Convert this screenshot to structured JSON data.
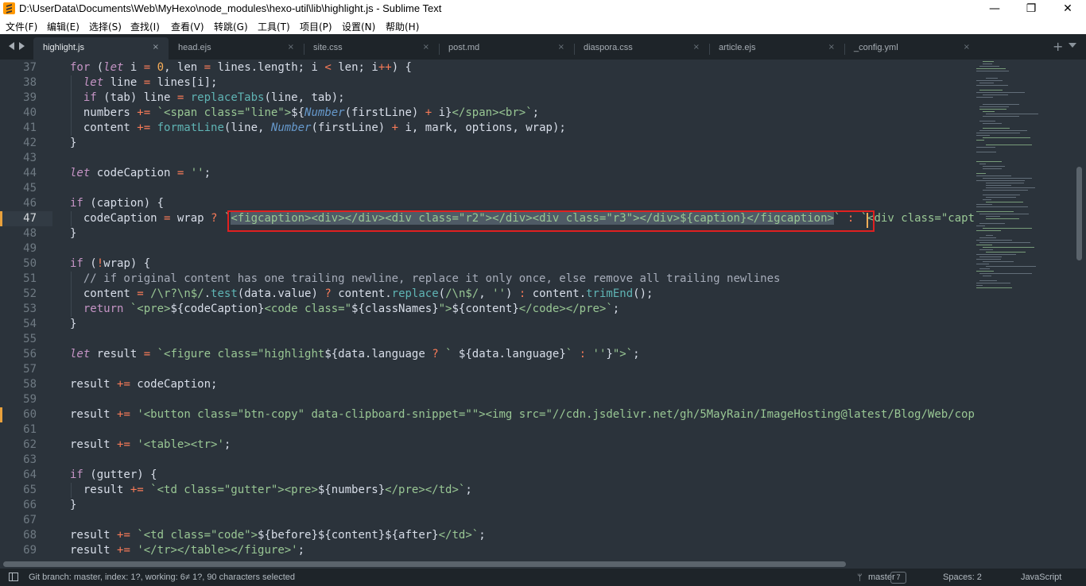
{
  "window": {
    "title": "D:\\UserData\\Documents\\Web\\MyHexo\\node_modules\\hexo-util\\lib\\highlight.js - Sublime Text",
    "minimize_glyph": "—",
    "maximize_glyph": "❐",
    "close_glyph": "✕"
  },
  "menu": [
    "文件(F)",
    "编辑(E)",
    "选择(S)",
    "查找(I)",
    "查看(V)",
    "转跳(G)",
    "工具(T)",
    "项目(P)",
    "设置(N)",
    "帮助(H)"
  ],
  "tabs": [
    {
      "label": "highlight.js",
      "active": true
    },
    {
      "label": "head.ejs",
      "active": false
    },
    {
      "label": "site.css",
      "active": false
    },
    {
      "label": "post.md",
      "active": false
    },
    {
      "label": "diaspora.css",
      "active": false
    },
    {
      "label": "article.ejs",
      "active": false
    },
    {
      "label": "_config.yml",
      "active": false
    }
  ],
  "tab_close_glyph": "×",
  "tab_add_glyph": "+",
  "editor": {
    "line_numbers": [
      "37",
      "38",
      "39",
      "40",
      "41",
      "42",
      "43",
      "44",
      "45",
      "46",
      "47",
      "48",
      "49",
      "50",
      "51",
      "52",
      "53",
      "54",
      "55",
      "56",
      "57",
      "58",
      "59",
      "60",
      "61",
      "62",
      "63",
      "64",
      "65",
      "66",
      "67",
      "68",
      "69"
    ],
    "current_line": "47",
    "modified_lines": [
      "47",
      "60"
    ],
    "selection_text": "<figcaption><div></div><div class=\"r2\"></div><div class=\"r3\"></div>${caption}</figcaption>"
  },
  "status": {
    "git": "Git branch: master, index: 1?, working: 6≠ 1?, 90 characters selected",
    "branch": "master",
    "branch_badge": "7",
    "spaces": "Spaces: 2",
    "syntax": "JavaScript"
  },
  "icons": {
    "app": "sublime-text-logo-icon",
    "panel": "toggle-panel-icon",
    "branch": "git-branch-icon"
  },
  "colors": {
    "background": "#2b333b",
    "chrome": "#1e2429",
    "selection_box": "#e02020",
    "keyword": "#c594c5",
    "operator": "#f97b58",
    "string": "#99c794",
    "function": "#5fb4b4",
    "number": "#f9ae58"
  }
}
